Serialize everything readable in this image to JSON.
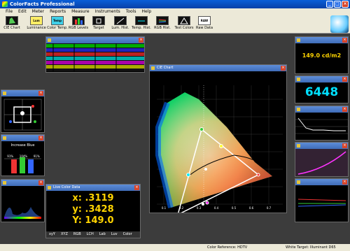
{
  "app": {
    "title": "ColorFacts Professional"
  },
  "menu": [
    "File",
    "Edit",
    "Meter",
    "Reports",
    "Measure",
    "Instruments",
    "Tools",
    "Help"
  ],
  "toolbar": [
    {
      "label": "CIE Chart",
      "icon": "cie-chart-icon",
      "tag": ""
    },
    {
      "label": "Luminance",
      "icon": "luminance-icon",
      "tag": "Lum"
    },
    {
      "label": "Color Temp.",
      "icon": "color-temp-icon",
      "tag": "Temp"
    },
    {
      "label": "RGB Levels",
      "icon": "rgb-levels-icon",
      "tag": ""
    },
    {
      "label": "Target",
      "icon": "target-icon",
      "tag": ""
    },
    {
      "label": "Lum. Hist.",
      "icon": "lum-hist-icon",
      "tag": ""
    },
    {
      "label": "Temp. Hist.",
      "icon": "temp-hist-icon",
      "tag": ""
    },
    {
      "label": "RGB Hist.",
      "icon": "rgb-hist-icon",
      "tag": ""
    },
    {
      "label": "Test Colors",
      "icon": "test-colors-icon",
      "tag": ""
    },
    {
      "label": "Raw Data",
      "icon": "raw-data-icon",
      "tag": "RAW"
    }
  ],
  "cie": {
    "title": "CIE Chart",
    "ticks": [
      "0.1",
      "0.2",
      "0.3",
      "0.4",
      "0.5",
      "0.6",
      "0.7"
    ]
  },
  "luminance": {
    "value": "149.0 cd/m2"
  },
  "color_temp": {
    "value": "6448"
  },
  "rgb_levels": {
    "label": "Increase Blue",
    "values": [
      "91%",
      "104%",
      "91%"
    ]
  },
  "live": {
    "title": "Live Color Data",
    "x": "x: .3119",
    "y": "y: .3428",
    "Y": "Y: 149.0",
    "tabs": [
      "xyY",
      "XYZ",
      "RGB",
      "LCH",
      "Lab",
      "Luv",
      "Color"
    ]
  },
  "status": {
    "ref": "Color Reference: HDTV",
    "target": "White Target: Illuminant D65"
  },
  "colors": {
    "accent": "#ffd400",
    "cyan": "#00e0ff",
    "title_blue": "#3f6cb8"
  }
}
